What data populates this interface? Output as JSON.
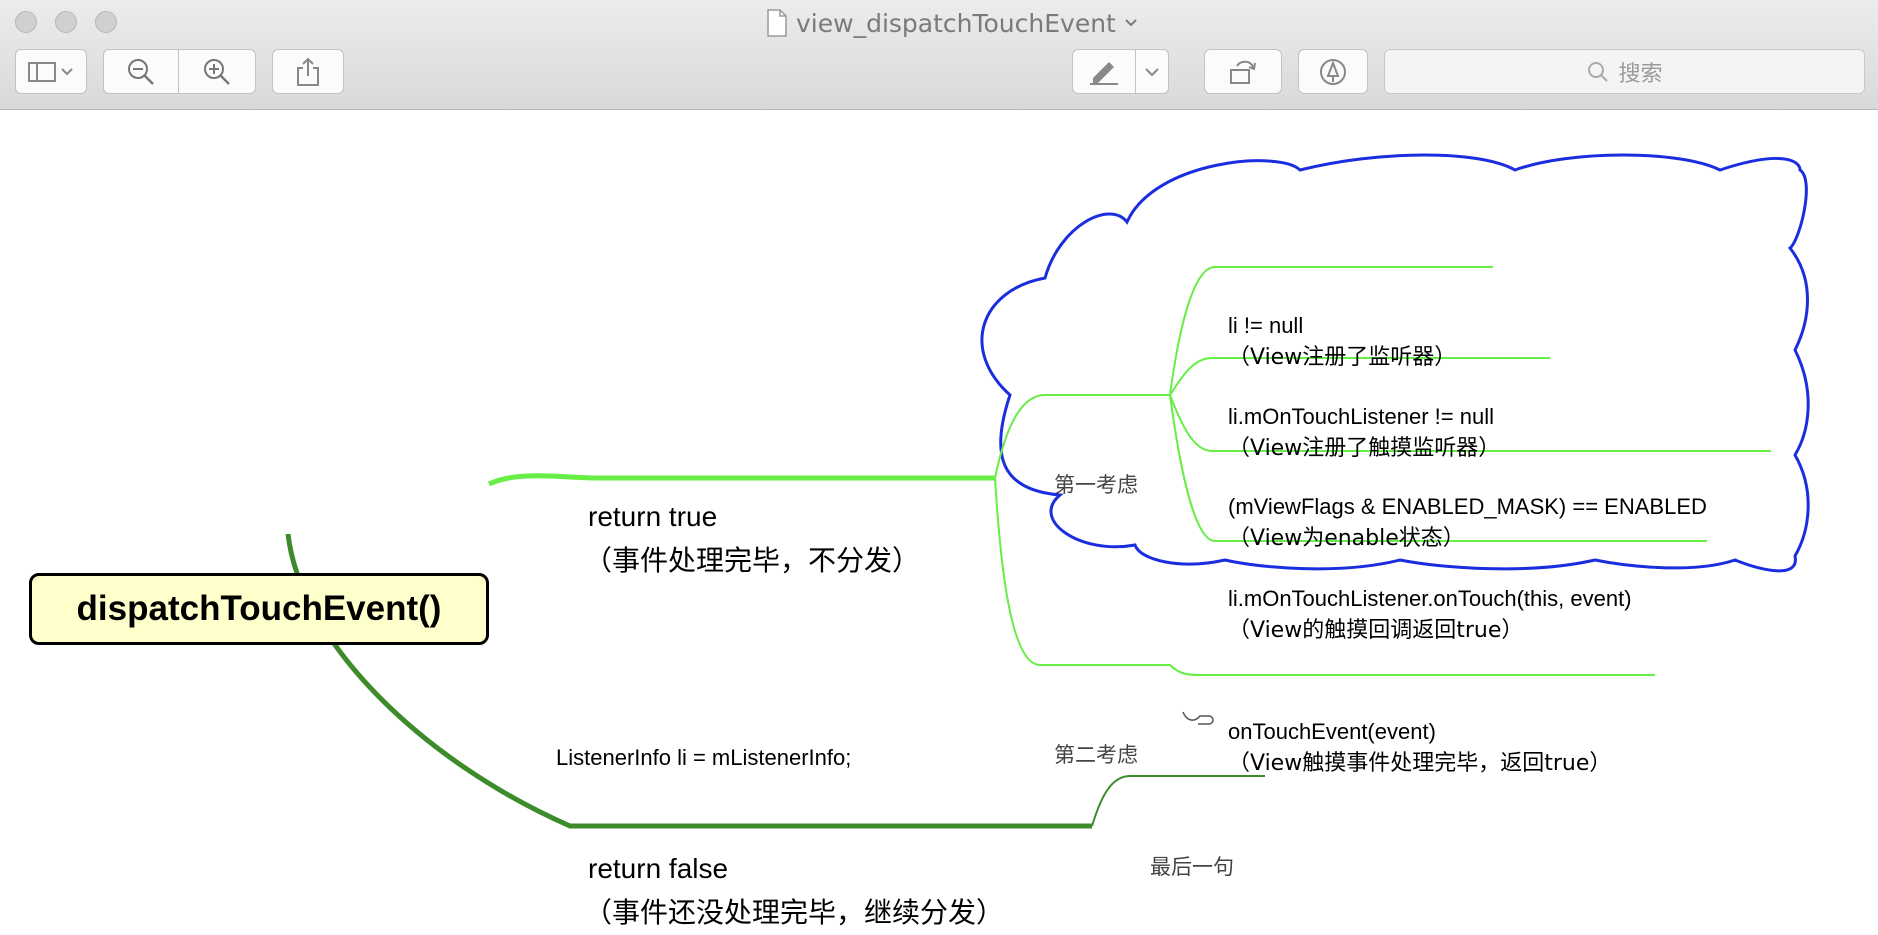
{
  "window": {
    "title": "view_dispatchTouchEvent",
    "search_placeholder": "搜索"
  },
  "toolbar": {
    "sidebar_icon": "sidebar-icon",
    "zoom_out_icon": "zoom-out-icon",
    "zoom_in_icon": "zoom-in-icon",
    "share_icon": "share-icon",
    "markup_icon": "highlighter-icon",
    "rotate_icon": "rotate-icon",
    "annotate_icon": "pen-circle-icon",
    "search_icon": "search-icon"
  },
  "mindmap": {
    "root": "dispatchTouchEvent()",
    "return_true": {
      "line1": "return true",
      "line2": "（事件处理完毕，不分发）"
    },
    "return_false": {
      "line1": "return false",
      "line2": "（事件还没处理完毕，继续分发）"
    },
    "listener_info": "ListenerInfo li = mListenerInfo;",
    "first_consider": "第一考虑",
    "second_consider": "第二考虑",
    "last_line": "最后一句",
    "conditions": [
      {
        "code": "li != null",
        "desc": "（View注册了监听器）"
      },
      {
        "code": "li.mOnTouchListener != null",
        "desc": "（View注册了触摸监听器）"
      },
      {
        "code": "(mViewFlags & ENABLED_MASK) == ENABLED",
        "desc": "（View为enable状态）"
      },
      {
        "code": "li.mOnTouchListener.onTouch(this, event)",
        "desc": "（View的触摸回调返回true）"
      }
    ],
    "on_touch_event": {
      "code": "onTouchEvent(event)",
      "desc": "（View触摸事件处理完毕，返回true）"
    },
    "colors": {
      "light_branch": "#66ee44",
      "dark_branch": "#3d8b2a",
      "cloud": "#1a2ee0",
      "root_fill": "#ffffcc"
    }
  }
}
